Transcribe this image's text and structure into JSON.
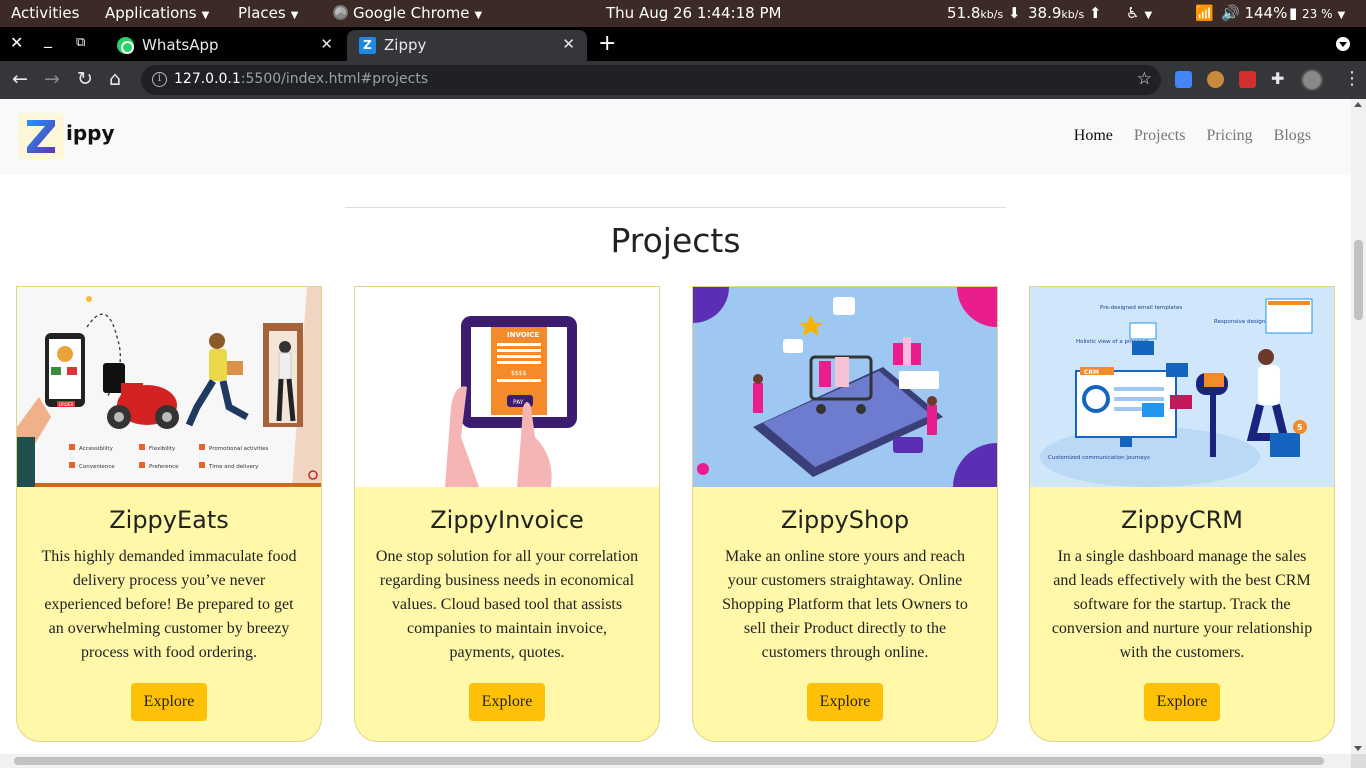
{
  "system_bar": {
    "activities": "Activities",
    "applications": "Applications",
    "places": "Places",
    "app_name": "Google Chrome",
    "datetime": "Thu Aug 26   1:44:18 PM",
    "net_down": "51.8",
    "net_down_unit": "kb/s",
    "net_up": "38.9",
    "net_up_unit": "kb/s",
    "volume": "144%",
    "battery": "23 %"
  },
  "tabs": [
    {
      "title": "WhatsApp",
      "icon": "whatsapp-icon",
      "active": false
    },
    {
      "title": "Zippy",
      "icon": "zippy-favicon",
      "active": true
    }
  ],
  "address_bar": {
    "host": "127.0.0.1",
    "rest": ":5500/index.html#projects"
  },
  "site": {
    "brand": "ippy",
    "logo_letter": "Z",
    "nav": [
      "Home",
      "Projects",
      "Pricing",
      "Blogs"
    ],
    "active_nav": "Home"
  },
  "section": {
    "title": "Projects"
  },
  "projects": [
    {
      "title": "ZippyEats",
      "description": "This highly demanded immaculate food delivery process you’ve never experienced before! Be prepared to get an overwhelming customer by breezy process with food ordering.",
      "button": "Explore",
      "image_labels": [
        "Accessibility",
        "Flexibility",
        "Promotional activities",
        "Convenience",
        "Preference",
        "Time and delivery",
        "ORDER"
      ]
    },
    {
      "title": "ZippyInvoice",
      "description": "One stop solution for all your correlation regarding business needs in economical values. Cloud based tool that assists companies to maintain invoice, payments, quotes.",
      "button": "Explore",
      "image_labels": [
        "INVOICE",
        "$$$$",
        "PAY"
      ]
    },
    {
      "title": "ZippyShop",
      "description": "Make an online store yours and reach your customers straightaway. Online Shopping Platform that lets Owners to sell their Product directly to the customers through online.",
      "button": "Explore",
      "image_labels": []
    },
    {
      "title": "ZippyCRM",
      "description": "In a single dashboard manage the sales and leads effectively with the best CRM software for the startup. Track the conversion and nurture your relationship with the customers.",
      "button": "Explore",
      "image_labels": [
        "Pre-designed email templates",
        "Responsive design",
        "Holistic view of a prospect",
        "CRM",
        "Customized communication journeys",
        "5"
      ]
    }
  ],
  "colors": {
    "card_bg": "#fff8a8",
    "button": "#ffc107",
    "topbar": "#3b2a26",
    "chrome_toolbar": "#35363a"
  }
}
